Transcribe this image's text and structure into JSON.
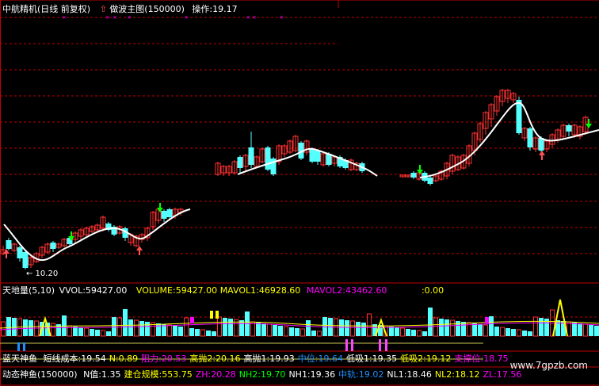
{
  "main_panel": {
    "title": "中航精机(日线 前复权)",
    "indicator_name": "做波主图(150000)",
    "operate_label": "操作:19.17",
    "low_label": "← 10.20"
  },
  "volume_panel": {
    "name": "天地量(5,10)",
    "vol": "VVOL:59427.00",
    "volume": "VOLUME:59427.00",
    "mavol1": "MAVOL1:46928.60",
    "mavol2": "MAVOL2:43462.60",
    "extra": ":0.00"
  },
  "blue_panel": {
    "name": "蓝天神鱼",
    "items": [
      {
        "label": "短线成本:19.54",
        "color": "#ffffff"
      },
      {
        "label": "N:0.89",
        "color": "#ffff00"
      },
      {
        "label": "阻力:20.53",
        "color": "#ff00ff"
      },
      {
        "label": "高抛2:20.16",
        "color": "#ffff00"
      },
      {
        "label": "高抛1:19.93",
        "color": "#ffffff"
      },
      {
        "label": "中位:19.64",
        "color": "#1e90ff"
      },
      {
        "label": "低吸1:19.35",
        "color": "#ffffff"
      },
      {
        "label": "低吸2:19.12",
        "color": "#ffff00"
      },
      {
        "label": "支撑位:18.75",
        "color": "#ff00ff"
      }
    ]
  },
  "dynamic_panel": {
    "name": "动态神鱼(150000)",
    "items": [
      {
        "label": "N值:1.35",
        "color": "#ffffff"
      },
      {
        "label": "建仓规模:553.75",
        "color": "#ffff00"
      },
      {
        "label": "ZH:20.28",
        "color": "#ff00ff"
      },
      {
        "label": "NH2:19.70",
        "color": "#00ff00"
      },
      {
        "label": "NH1:19.36",
        "color": "#ffffff"
      },
      {
        "label": "中轨:19.02",
        "color": "#1e90ff"
      },
      {
        "label": "NL1:18.46",
        "color": "#ffffff"
      },
      {
        "label": "NL2:18.12",
        "color": "#ffff00"
      },
      {
        "label": "ZL:17.56",
        "color": "#ff00ff"
      }
    ]
  },
  "watermark": "www.7gpzb.com",
  "colors": {
    "up": "#ff3232",
    "down": "#54ffff",
    "ma": "#ffffff",
    "grid": "#c00000"
  }
}
